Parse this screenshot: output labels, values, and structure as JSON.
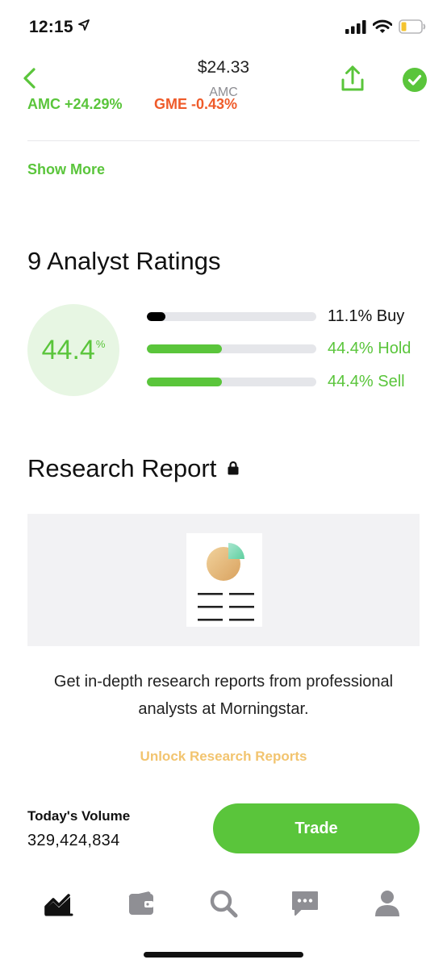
{
  "status_bar": {
    "time": "12:15",
    "location_icon": "location-arrow-icon",
    "signal_icon": "cellular-signal-icon",
    "wifi_icon": "wifi-icon",
    "battery_icon": "battery-low-icon"
  },
  "header": {
    "price": "$24.33",
    "symbol": "AMC",
    "back_icon": "chevron-left-icon",
    "share_icon": "share-icon",
    "added_icon": "checkmark-circle-icon"
  },
  "tickers": [
    {
      "label": "AMC +24.29%",
      "direction": "up"
    },
    {
      "label": "GME -0.43%",
      "direction": "down"
    }
  ],
  "show_more": "Show More",
  "analyst": {
    "title": "9 Analyst Ratings",
    "headline_value": "44.4",
    "headline_unit": "%",
    "ratings": [
      {
        "label": "11.1% Buy",
        "fraction": 0.111,
        "color": "#000000"
      },
      {
        "label": "44.4% Hold",
        "fraction": 0.444,
        "color": "#5ac53b"
      },
      {
        "label": "44.4% Sell",
        "fraction": 0.444,
        "color": "#5ac53b"
      }
    ]
  },
  "research": {
    "title": "Research Report",
    "lock_icon": "lock-icon",
    "illustration_icon": "report-document-icon",
    "description": "Get in-depth research reports from professional analysts at Morningstar.",
    "unlock_label": "Unlock Research Reports"
  },
  "volume": {
    "label": "Today's Volume",
    "value": "329,424,834"
  },
  "trade_label": "Trade",
  "tab_bar": [
    {
      "icon": "chart-icon",
      "active": true
    },
    {
      "icon": "wallet-icon",
      "active": false
    },
    {
      "icon": "search-icon",
      "active": false
    },
    {
      "icon": "messages-icon",
      "active": false
    },
    {
      "icon": "account-icon",
      "active": false
    }
  ],
  "colors": {
    "accent": "#5ac53b",
    "negative": "#ef5b2a",
    "unlock": "#f2c46f"
  }
}
